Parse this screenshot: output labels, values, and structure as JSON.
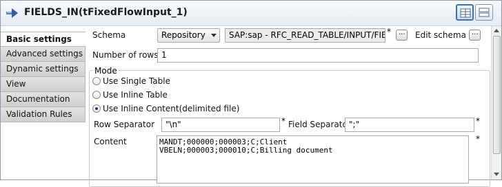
{
  "title": "FIELDS_IN(tFixedFlowInput_1)",
  "tabs": [
    {
      "label": "Basic settings",
      "active": true
    },
    {
      "label": "Advanced settings"
    },
    {
      "label": "Dynamic settings"
    },
    {
      "label": "View"
    },
    {
      "label": "Documentation"
    },
    {
      "label": "Validation Rules"
    }
  ],
  "schema": {
    "label": "Schema",
    "type_value": "Repository",
    "path_value": "SAP:sap - RFC_READ_TABLE/INPUT/FIELDS",
    "required_mark": "*",
    "edit_label": "Edit schema",
    "dots": "..."
  },
  "rows": {
    "label": "Number of rows",
    "value": "1"
  },
  "mode": {
    "title": "Mode",
    "options": [
      "Use Single Table",
      "Use Inline Table",
      "Use Inline Content(delimited file)"
    ],
    "selected": 2
  },
  "separators": {
    "row_label": "Row Separator",
    "row_value": "\"\\n\"",
    "field_label": "Field Separator",
    "field_value": "\";\"",
    "required_mark": "*"
  },
  "content": {
    "label": "Content",
    "lines": [
      "MANDT;000000;000003;C;Client",
      "VBELN;000003;000010;C;Billing document"
    ],
    "required_mark": "*"
  },
  "colors": {
    "accent": "#3f6fb5",
    "active_tab_bg": "#ffffff",
    "tab_bg": "#d9d9d9"
  }
}
